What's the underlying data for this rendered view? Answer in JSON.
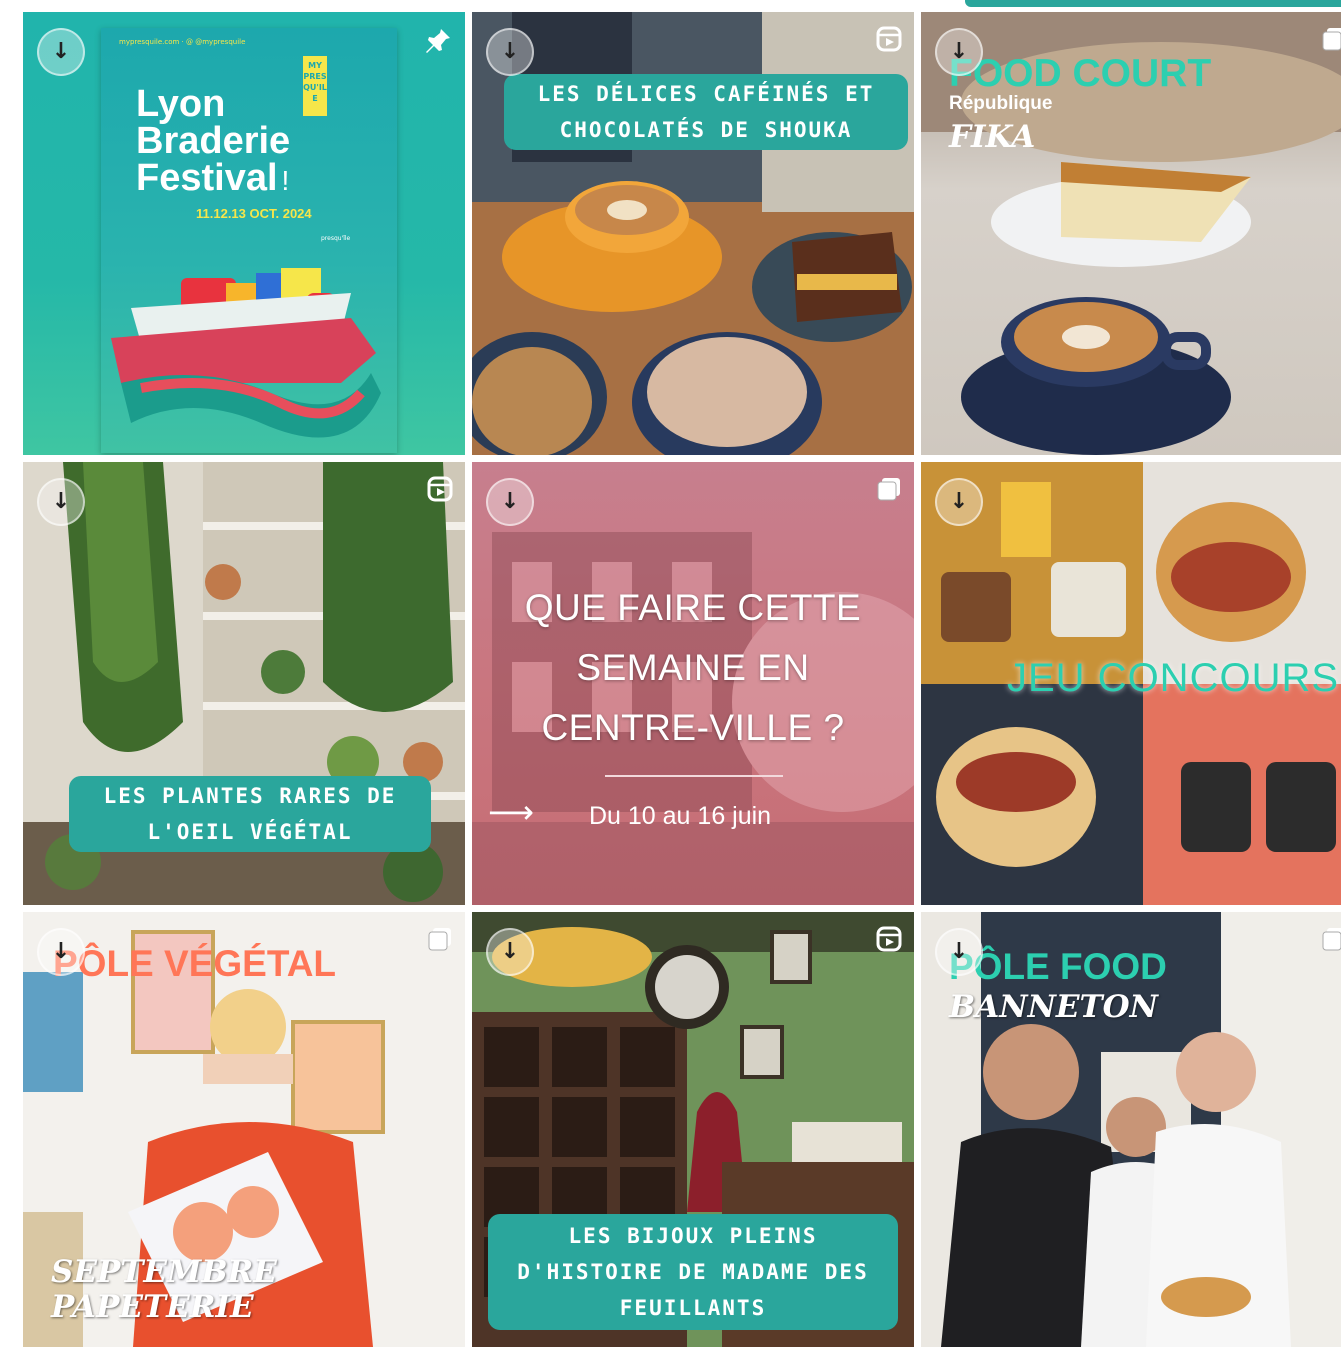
{
  "grid": {
    "tiles": [
      {
        "id": "braderie",
        "poster_top_line": "mypresquile.com  ·  @ @mypresquile",
        "brand_logo": "MY PRES QU'ILE",
        "title": "Lyon Braderie Festival",
        "title_line1": "Lyon",
        "title_line2": "Braderie",
        "title_line3": "Festival",
        "title_mark": "!",
        "dates": "11.12.13 OCT. 2024",
        "poster_small": "presqu'île",
        "corner_icon": "pin-icon"
      },
      {
        "id": "shouka",
        "pill_line1": "LES DÉLICES CAFÉINÉS ET",
        "pill_line2": "CHOCOLATÉS DE SHOUKA",
        "corner_icon": "reel-icon"
      },
      {
        "id": "fika",
        "heading": "FOOD COURT",
        "subheading": "République",
        "label": "FIKA",
        "corner_icon": "multi-icon"
      },
      {
        "id": "oeil-vegetal",
        "pill_line1": "LES PLANTES RARES DE",
        "pill_line2": "L'OEIL VÉGÉTAL",
        "corner_icon": "reel-icon"
      },
      {
        "id": "semaine",
        "title_line1": "QUE FAIRE CETTE",
        "title_line2": "SEMAINE EN",
        "title_line3": "CENTRE-VILLE ?",
        "arrow": "⟶",
        "dates": "Du 10 au 16 juin",
        "corner_icon": "multi-icon"
      },
      {
        "id": "concours",
        "heading": "JEU CONCOURS",
        "corner_icon": "none"
      },
      {
        "id": "septembre",
        "heading": "PÔLE VÉGÉTAL",
        "label_line1": "SEPTEMBRE",
        "label_line2": "PAPETERIE",
        "corner_icon": "multi-icon"
      },
      {
        "id": "feuillants",
        "pill_line1": "LES BIJOUX PLEINS",
        "pill_line2": "D'HISTOIRE DE MADAME DES",
        "pill_line3": "FEUILLANTS",
        "corner_icon": "reel-icon"
      },
      {
        "id": "banneton",
        "heading": "PÔLE FOOD",
        "label": "BANNETON",
        "corner_icon": "multi-icon"
      }
    ]
  },
  "colors": {
    "teal": "#2aa69c",
    "mint_title": "#2ccfb0",
    "coral_title": "#ff7657",
    "poster_bg": "#1fb2aa",
    "poster_yellow": "#f6e64a"
  }
}
